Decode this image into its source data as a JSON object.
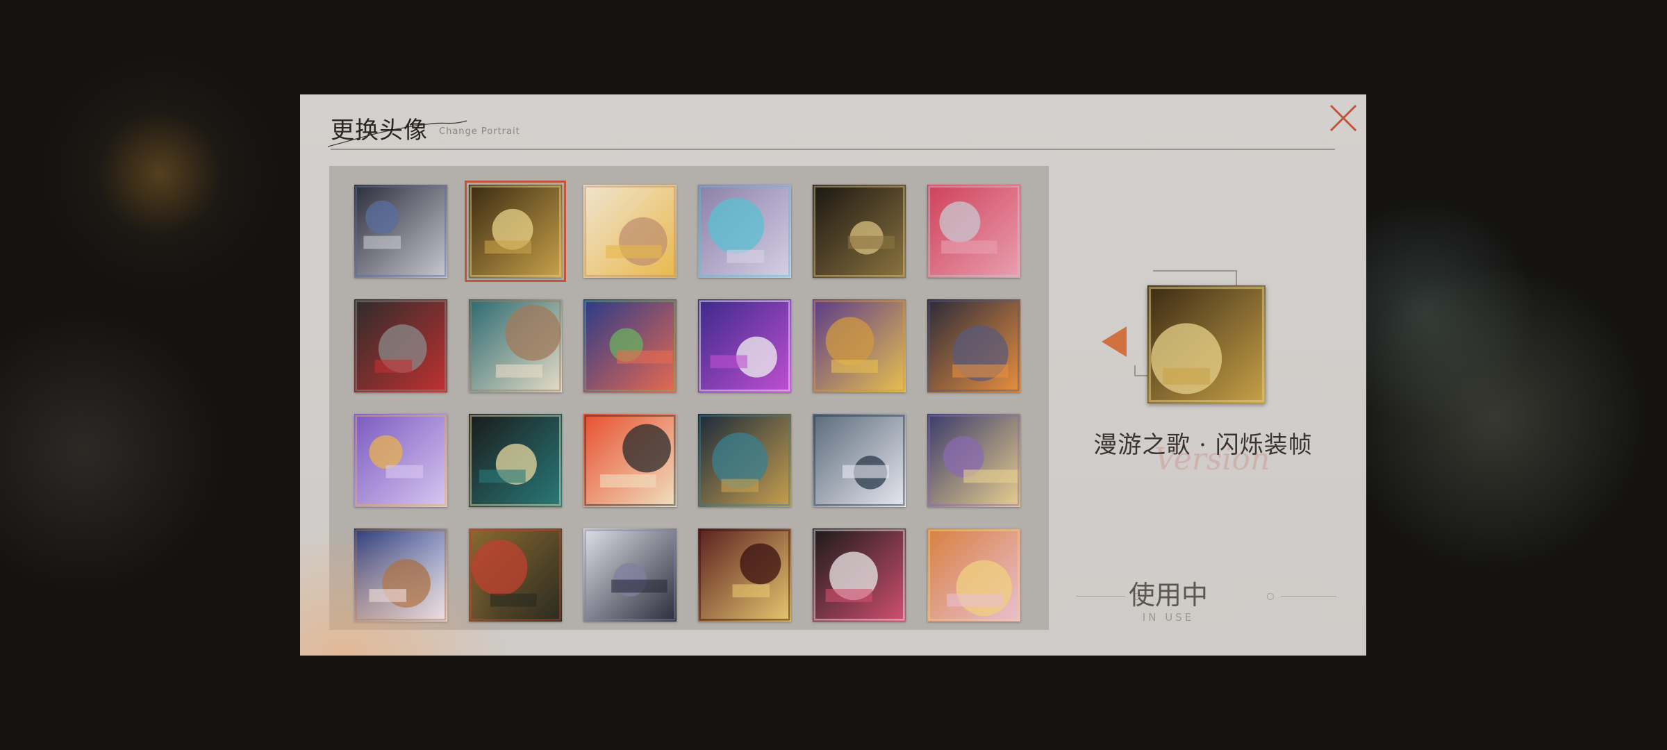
{
  "dialog": {
    "title": "更换头像",
    "subtitle": "Change Portrait",
    "close_icon": "close-icon"
  },
  "avatars": [
    {
      "name": "avatar-top-hat-girl",
      "selected": false,
      "colors": [
        "#2b2d3a",
        "#c9c9d1",
        "#5a6ea0"
      ]
    },
    {
      "name": "avatar-golden-theater",
      "selected": true,
      "colors": [
        "#3a2a12",
        "#c8a24a",
        "#e8d28a"
      ]
    },
    {
      "name": "avatar-sunflower-stairs",
      "selected": false,
      "colors": [
        "#f0e4d0",
        "#e8b84a",
        "#c09070"
      ]
    },
    {
      "name": "avatar-floating-cards",
      "selected": false,
      "colors": [
        "#8a80a8",
        "#d6d0e6",
        "#5ac0d0"
      ]
    },
    {
      "name": "avatar-number-one",
      "selected": false,
      "colors": [
        "#1a1612",
        "#8c7440",
        "#d8c080"
      ]
    },
    {
      "name": "avatar-disco-ball",
      "selected": false,
      "colors": [
        "#d0405a",
        "#e8a0b0",
        "#c8c8d0"
      ]
    },
    {
      "name": "avatar-red-neon-road",
      "selected": false,
      "colors": [
        "#2e2c2c",
        "#c03030",
        "#8a8a8a"
      ]
    },
    {
      "name": "avatar-musician-girl",
      "selected": false,
      "colors": [
        "#2a6a70",
        "#e8dcc8",
        "#a07a5a"
      ]
    },
    {
      "name": "avatar-colorful-town",
      "selected": false,
      "colors": [
        "#2a3a8a",
        "#e86a50",
        "#6ab060"
      ]
    },
    {
      "name": "avatar-2024-ribbons",
      "selected": false,
      "colors": [
        "#3a2a8a",
        "#c050d0",
        "#f0f0f0"
      ]
    },
    {
      "name": "avatar-clock-tower",
      "selected": false,
      "colors": [
        "#5a3a8a",
        "#e8c050",
        "#d09a40"
      ]
    },
    {
      "name": "avatar-moon-phases",
      "selected": false,
      "colors": [
        "#2a2a3a",
        "#e89040",
        "#5a5a7a"
      ]
    },
    {
      "name": "avatar-purple-swirl",
      "selected": false,
      "colors": [
        "#7a5ac0",
        "#d8c8f0",
        "#e8b050"
      ]
    },
    {
      "name": "avatar-black-cat",
      "selected": false,
      "colors": [
        "#1a1a1a",
        "#2a7a7a",
        "#e8d8a0"
      ]
    },
    {
      "name": "avatar-koi-fish",
      "selected": false,
      "colors": [
        "#e85030",
        "#f0e0c0",
        "#2a2a2a"
      ]
    },
    {
      "name": "avatar-plague-doctor",
      "selected": false,
      "colors": [
        "#1a2a3a",
        "#c8a050",
        "#3a8090"
      ]
    },
    {
      "name": "avatar-broken-cage",
      "selected": false,
      "colors": [
        "#5a6a7a",
        "#e8e8f0",
        "#2a3a4a"
      ]
    },
    {
      "name": "avatar-masked-figure",
      "selected": false,
      "colors": [
        "#3a3a6a",
        "#e8d090",
        "#8a6ab0"
      ]
    },
    {
      "name": "avatar-star-mask",
      "selected": false,
      "colors": [
        "#2a3a7a",
        "#f0f0ff",
        "#a06a40"
      ]
    },
    {
      "name": "avatar-infinity-knot",
      "selected": false,
      "colors": [
        "#8a6a30",
        "#2a2a20",
        "#c04030"
      ]
    },
    {
      "name": "avatar-record-player",
      "selected": false,
      "colors": [
        "#e0e0e8",
        "#2a2a3a",
        "#8080a0"
      ]
    },
    {
      "name": "avatar-fox-mask",
      "selected": false,
      "colors": [
        "#5a2020",
        "#e8c870",
        "#3a1010"
      ]
    },
    {
      "name": "avatar-tea-party",
      "selected": false,
      "colors": [
        "#1a1a1a",
        "#d05070",
        "#e8e8e8"
      ]
    },
    {
      "name": "avatar-stained-glass",
      "selected": false,
      "colors": [
        "#d88040",
        "#e8c0d0",
        "#f0d080"
      ]
    }
  ],
  "preview": {
    "name": "漫游之歌 · 闪烁装帧",
    "script_text": "Version",
    "prev_icon": "arrow-left-icon"
  },
  "status": {
    "label": "使用中",
    "sublabel": "IN USE"
  },
  "colors": {
    "accent": "#c0553a",
    "arrow": "#d0713f",
    "panel_bg": "#d3d0cd",
    "grid_bg": "#b3afab"
  }
}
